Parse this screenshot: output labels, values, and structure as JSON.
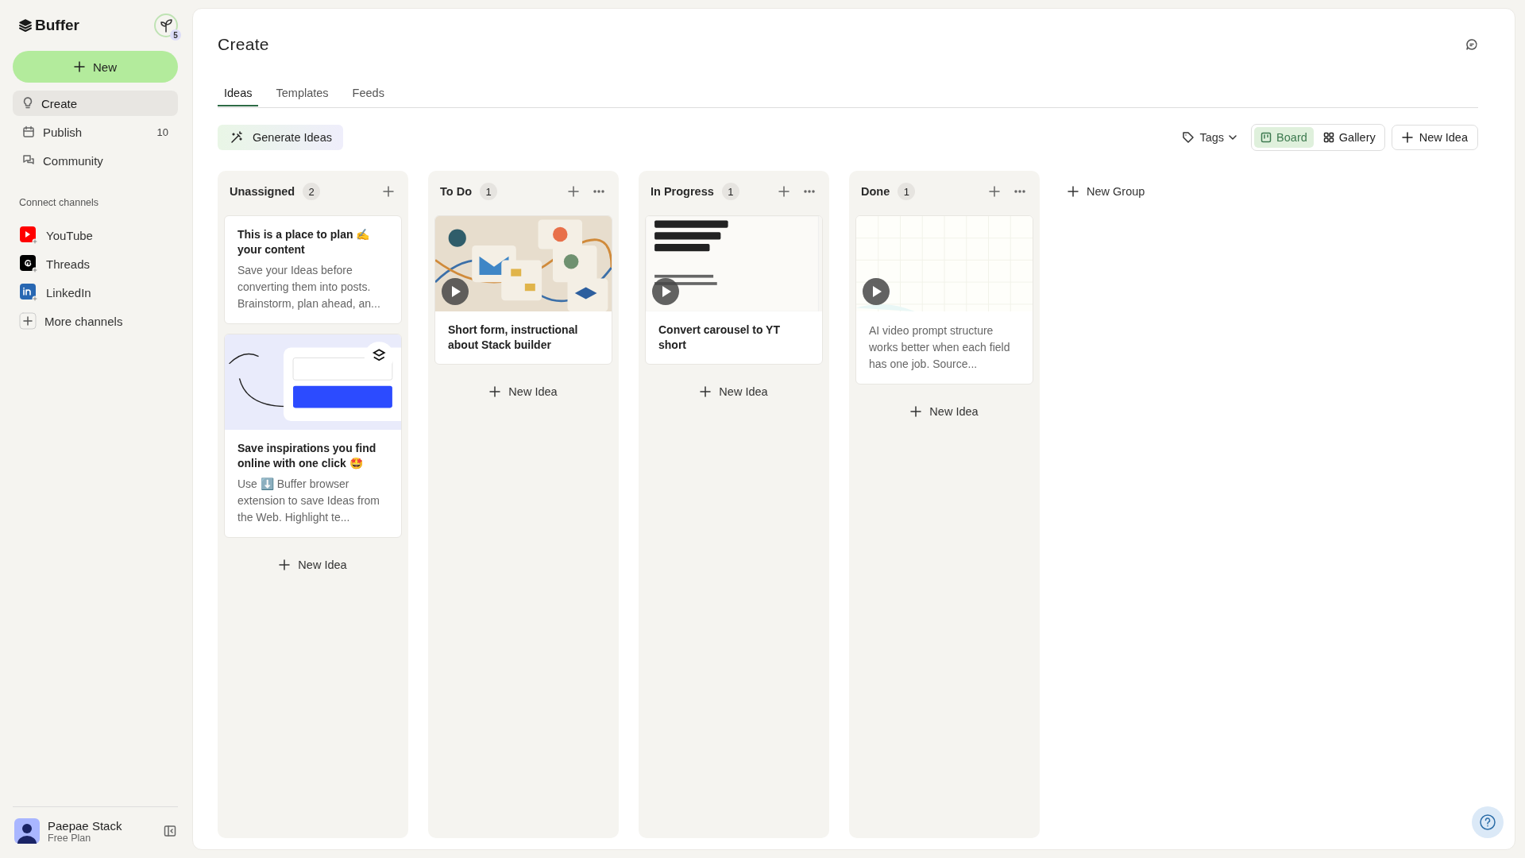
{
  "sidebar": {
    "logo": "Buffer",
    "badge": "5",
    "new_button": "New",
    "nav": [
      {
        "label": "Create",
        "selected": true
      },
      {
        "label": "Publish",
        "count": "10",
        "selected": false
      },
      {
        "label": "Community",
        "selected": false
      }
    ],
    "section_label": "Connect channels",
    "channels": [
      {
        "label": "YouTube",
        "kind": "youtube"
      },
      {
        "label": "Threads",
        "kind": "threads"
      },
      {
        "label": "LinkedIn",
        "kind": "linkedin"
      },
      {
        "label": "More channels",
        "kind": "more"
      }
    ],
    "user": {
      "name": "Paepae Stack",
      "plan": "Free Plan"
    }
  },
  "main": {
    "title": "Create",
    "tabs": [
      {
        "label": "Ideas",
        "selected": true
      },
      {
        "label": "Templates",
        "selected": false
      },
      {
        "label": "Feeds",
        "selected": false
      }
    ],
    "generate_button": "Generate Ideas",
    "tags_button": "Tags",
    "views": [
      {
        "label": "Board",
        "selected": true
      },
      {
        "label": "Gallery",
        "selected": false
      }
    ],
    "new_idea_button": "New Idea",
    "columns": [
      {
        "name": "Unassigned",
        "count": "2",
        "menu": false,
        "add_label": "New Idea",
        "cards": [
          {
            "title": "This is a place to plan ✍️ your content",
            "body": "Save your Ideas before converting them into posts. Brainstorm, plan ahead, an..."
          },
          {
            "thumbnail": {
              "kind": "picture",
              "video": false
            },
            "title": "Save inspirations you find online with one click 🤩",
            "body": "Use ⬇️ Buffer browser extension to save Ideas from the Web. Highlight te..."
          }
        ]
      },
      {
        "name": "To Do",
        "count": "1",
        "menu": true,
        "add_label": "New Idea",
        "cards": [
          {
            "thumbnail": {
              "kind": "picture",
              "video": true
            },
            "title": "Short form, instructional about Stack builder"
          }
        ]
      },
      {
        "name": "In Progress",
        "count": "1",
        "menu": true,
        "add_label": "New Idea",
        "cards": [
          {
            "thumbnail": {
              "kind": "picture",
              "video": true
            },
            "title": "Convert carousel to YT short"
          }
        ]
      },
      {
        "name": "Done",
        "count": "1",
        "menu": true,
        "add_label": "New Idea",
        "cards": [
          {
            "thumbnail": {
              "kind": "picture",
              "video": true
            },
            "body": "AI video prompt structure works better when each field has one job. Source..."
          }
        ]
      }
    ],
    "new_group": "New Group"
  }
}
